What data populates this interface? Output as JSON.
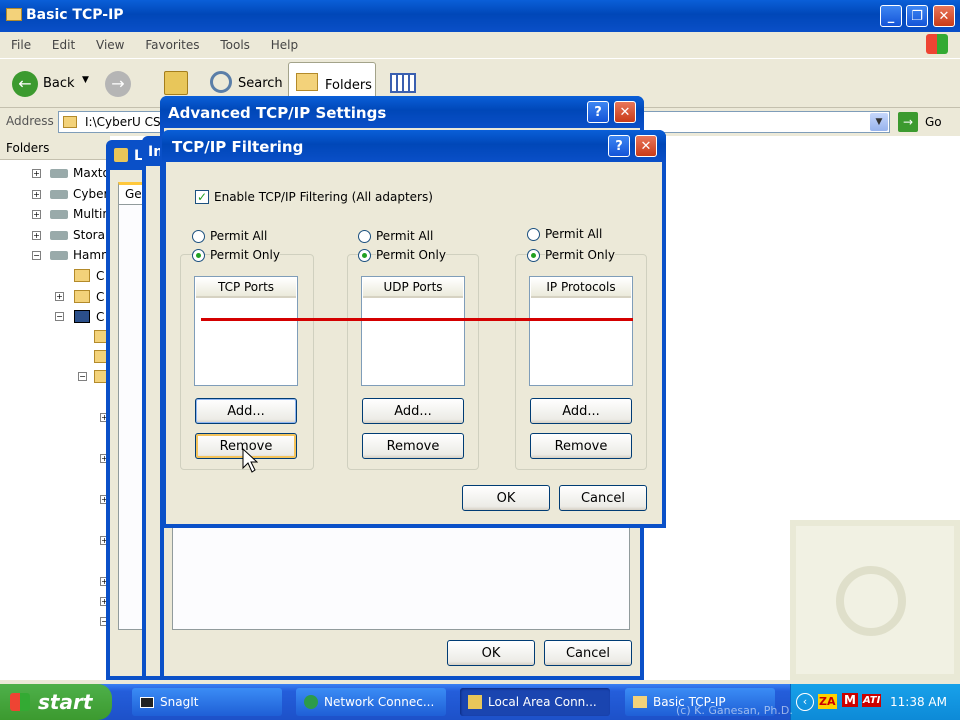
{
  "explorer": {
    "title": "Basic TCP-IP",
    "menu": [
      "File",
      "Edit",
      "View",
      "Favorites",
      "Tools",
      "Help"
    ],
    "toolbar": {
      "back": "Back",
      "search": "Search",
      "folders": "Folders"
    },
    "address_label": "Address",
    "address_value": "I:\\CyberU CS",
    "go_label": "Go",
    "folders_pane_label": "Folders",
    "tree": [
      "Maxto",
      "Cyber",
      "Multin",
      "Stora",
      "Hamm",
      "C",
      "C",
      "C"
    ]
  },
  "bg_dialog": {
    "tab_label": "Ge",
    "ok": "OK",
    "cancel": "Cancel"
  },
  "advanced": {
    "title": "Advanced TCP/IP Settings",
    "ok": "OK",
    "cancel": "Cancel"
  },
  "local_area_title": "L",
  "internet_title": "In",
  "filtering": {
    "title": "TCP/IP Filtering",
    "enable_label": "Enable TCP/IP Filtering (All adapters)",
    "enable_checked": true,
    "columns": [
      {
        "permit_all": "Permit All",
        "permit_only": "Permit Only",
        "header": "TCP Ports",
        "add": "Add...",
        "remove": "Remove"
      },
      {
        "permit_all": "Permit All",
        "permit_only": "Permit Only",
        "header": "UDP Ports",
        "add": "Add...",
        "remove": "Remove"
      },
      {
        "permit_all": "Permit All",
        "permit_only": "Permit Only",
        "header": "IP Protocols",
        "add": "Add...",
        "remove": "Remove"
      }
    ],
    "ok": "OK",
    "cancel": "Cancel",
    "annotation_color": "#d40000"
  },
  "taskbar": {
    "start": "start",
    "items": [
      "SnagIt",
      "Network Connec...",
      "Local Area Conn...",
      "Basic TCP-IP"
    ],
    "clock": "11:38 AM",
    "tray": [
      "ZA",
      "M",
      "ATI"
    ],
    "watermark": "(c) K. Ganesan, Ph.D."
  },
  "colors": {
    "title_blue": "#0a5fd8",
    "taskbar_blue": "#245edb",
    "start_green": "#3c9a2f"
  }
}
